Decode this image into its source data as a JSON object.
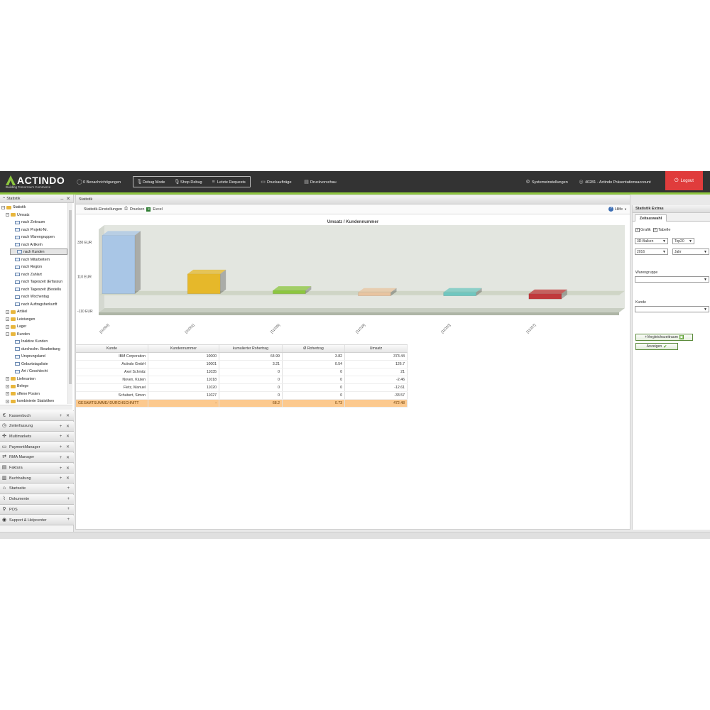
{
  "app": {
    "logo_text": "ACTINDO",
    "logo_tagline": "Building Tomorrow's Commerce"
  },
  "topbar": {
    "notifications": "0 Benachrichtigungen",
    "debug_mode": "Debug Mode",
    "shop_debug": "Shop Debug",
    "last_requests": "Letzte Requests",
    "print_jobs": "Druckaufträge",
    "print_preview": "Druckvorschau",
    "system_settings": "Systemeinstellungen",
    "account": "40281 - Actindo Präsentationsaccount",
    "logout": "Logout"
  },
  "left_panel": {
    "title": "Statistik",
    "tree": [
      {
        "label": "Statistik",
        "kind": "folder",
        "level": 0,
        "expander": "-"
      },
      {
        "label": "Umsatz",
        "kind": "folder",
        "level": 1,
        "expander": "-"
      },
      {
        "label": "nach Zeitraum",
        "kind": "doc",
        "level": 2
      },
      {
        "label": "nach Projekt-Nr.",
        "kind": "doc",
        "level": 2
      },
      {
        "label": "nach Warengruppen",
        "kind": "doc",
        "level": 2
      },
      {
        "label": "nach Artikeln",
        "kind": "doc",
        "level": 2
      },
      {
        "label": "nach Kunden",
        "kind": "doc",
        "level": 2,
        "selected": true
      },
      {
        "label": "nach Mitarbeitern",
        "kind": "doc",
        "level": 2
      },
      {
        "label": "nach Region",
        "kind": "doc",
        "level": 2
      },
      {
        "label": "nach Zahlart",
        "kind": "doc",
        "level": 2
      },
      {
        "label": "nach Tageszeit (Erfassun",
        "kind": "doc",
        "level": 2
      },
      {
        "label": "nach Tageszeit (Bestellu",
        "kind": "doc",
        "level": 2
      },
      {
        "label": "nach Wochentag",
        "kind": "doc",
        "level": 2
      },
      {
        "label": "nach Auftragsherkunft",
        "kind": "doc",
        "level": 2
      },
      {
        "label": "Artikel",
        "kind": "folder",
        "level": 1,
        "expander": "+"
      },
      {
        "label": "Leistungen",
        "kind": "folder",
        "level": 1,
        "expander": "+"
      },
      {
        "label": "Lager",
        "kind": "folder",
        "level": 1,
        "expander": "+"
      },
      {
        "label": "Kunden",
        "kind": "folder",
        "level": 1,
        "expander": "-"
      },
      {
        "label": "Inaktive Kunden",
        "kind": "doc",
        "level": 2
      },
      {
        "label": "durchschn. Bearbeitung",
        "kind": "doc",
        "level": 2
      },
      {
        "label": "Ursprungsland",
        "kind": "doc",
        "level": 2
      },
      {
        "label": "Geburtstagsliste",
        "kind": "doc",
        "level": 2
      },
      {
        "label": "Art / Geschlecht",
        "kind": "doc",
        "level": 2
      },
      {
        "label": "Lieferanten",
        "kind": "folder",
        "level": 1,
        "expander": "+"
      },
      {
        "label": "Belege",
        "kind": "folder",
        "level": 1,
        "expander": "+"
      },
      {
        "label": "offene Posten",
        "kind": "folder",
        "level": 1,
        "expander": "+"
      },
      {
        "label": "kombinierte Statistiken",
        "kind": "folder",
        "level": 1,
        "expander": "+"
      }
    ],
    "accordion": [
      {
        "label": "Kassenbuch",
        "icon": "€",
        "icon_name": "euro-icon",
        "controls": "+ ✕"
      },
      {
        "label": "Zeiterfassung",
        "icon": "◷",
        "icon_name": "clock-icon",
        "controls": "+ ✕"
      },
      {
        "label": "Multimarkets",
        "icon": "✣",
        "icon_name": "network-icon",
        "controls": "+ ✕"
      },
      {
        "label": "PaymentManager",
        "icon": "▭",
        "icon_name": "credit-card-icon",
        "controls": "+ ✕"
      },
      {
        "label": "RMA Manager",
        "icon": "⇄",
        "icon_name": "exchange-icon",
        "controls": "+ ✕"
      },
      {
        "label": "Faktura",
        "icon": "▤",
        "icon_name": "invoice-icon",
        "controls": "+ ✕"
      },
      {
        "label": "Buchhaltung",
        "icon": "▥",
        "icon_name": "books-icon",
        "controls": "+ ✕"
      },
      {
        "label": "Startseite",
        "icon": "⌂",
        "icon_name": "home-icon",
        "controls": "+"
      },
      {
        "label": "Dokumente",
        "icon": "⌇",
        "icon_name": "paperclip-icon",
        "controls": "+"
      },
      {
        "label": "POS",
        "icon": "⚲",
        "icon_name": "location-pin-icon",
        "controls": "+"
      },
      {
        "label": "Support & Helpcenter",
        "icon": "◉",
        "icon_name": "support-icon",
        "controls": "+"
      }
    ]
  },
  "main": {
    "title": "Statistik",
    "toolbar": {
      "settings": "Statistik-Einstellungen",
      "print": "Drucken",
      "excel": "Excel",
      "help": "Hilfe"
    },
    "table": {
      "columns": [
        "Kunde",
        "Kundennummer",
        "kumulierter Rohertrag",
        "Ø Rohertrag",
        "Umsatz"
      ],
      "rows": [
        [
          "IBM Corporation",
          "10000",
          "64.99",
          "3.82",
          "373.44"
        ],
        [
          "Actindo GmbH",
          "10001",
          "3.21",
          "0.54",
          "126.7"
        ],
        [
          "Axel Schmitz",
          "11035",
          "0",
          "0",
          "21"
        ],
        [
          "Noven, Kluten",
          "11018",
          "0",
          "0",
          "-2.46"
        ],
        [
          "Fletz, Manuel",
          "11020",
          "0",
          "0",
          "-12.61"
        ],
        [
          "Schubert, Simon",
          "11027",
          "0",
          "0",
          "-33.57"
        ]
      ],
      "total": [
        "GESAMTSUMME/-DURCHSCHNITT",
        "-",
        "68.2",
        "0.73",
        "472.48"
      ]
    }
  },
  "chart_data": {
    "type": "bar",
    "title": "Umsatz / Kundennummer",
    "categories": [
      "[10000]",
      "[10001]",
      "[11035]",
      "[11018]",
      "[11020]",
      "[11027]"
    ],
    "values": [
      373.44,
      126.7,
      21,
      -2.46,
      -12.61,
      -33.57
    ],
    "tick_labels": [
      "330 EUR",
      "110 EUR",
      "-110 EUR"
    ],
    "ticks": [
      330,
      110,
      -110
    ],
    "ylim": [
      -110,
      330
    ],
    "colors": [
      "#a9c6e6",
      "#e6b82a",
      "#8cc63f",
      "#e8c4a0",
      "#6fc7c0",
      "#c0393b"
    ],
    "grid": false
  },
  "right_panel": {
    "title": "Statistik Extras",
    "tab": "Zeitauswahl",
    "chk_grafik": "Grafik",
    "chk_tabelle": "Tabelle",
    "select_type": "3D-Balken",
    "select_top": "Top20",
    "select_year": "2016",
    "select_period": "Jahr",
    "label_warengruppe": "Warengruppe",
    "label_kunde": "Kunde",
    "btn_compare": "+Vergleichszeitraum",
    "btn_show": "Anzeigen"
  }
}
